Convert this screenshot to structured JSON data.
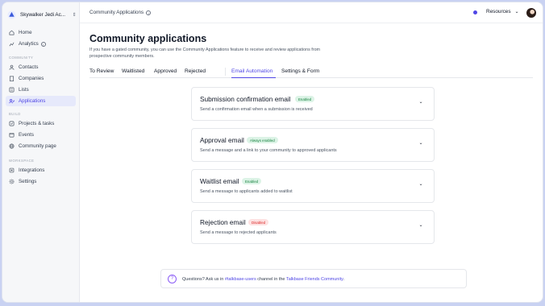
{
  "workspace": {
    "name": "Skywalker Jedi Ac...",
    "caret_icon": "chevron-updown-icon"
  },
  "sidebar": {
    "top_items": [
      {
        "label": "Home",
        "icon": "home-icon"
      },
      {
        "label": "Analytics",
        "icon": "chart-icon"
      }
    ],
    "sections": [
      {
        "title": "COMMUNITY",
        "items": [
          {
            "label": "Contacts",
            "icon": "contacts-icon"
          },
          {
            "label": "Companies",
            "icon": "building-icon"
          },
          {
            "label": "Lists",
            "icon": "list-icon"
          },
          {
            "label": "Applications",
            "icon": "applications-icon",
            "active": true
          }
        ]
      },
      {
        "title": "BUILD",
        "items": [
          {
            "label": "Projects & tasks",
            "icon": "tasks-icon"
          },
          {
            "label": "Events",
            "icon": "calendar-icon"
          },
          {
            "label": "Community page",
            "icon": "globe-icon"
          }
        ]
      },
      {
        "title": "WORKSPACE",
        "items": [
          {
            "label": "Integrations",
            "icon": "integrations-icon"
          },
          {
            "label": "Settings",
            "icon": "gear-icon"
          }
        ]
      }
    ]
  },
  "topbar": {
    "breadcrumb": "Community Applications",
    "resources_label": "Resources"
  },
  "page": {
    "title": "Community applications",
    "description": "If you have a gated community, you can use the Community Applications feature to receive and review applications from prospective community members."
  },
  "tabs": [
    {
      "label": "To Review"
    },
    {
      "label": "Waitlisted"
    },
    {
      "label": "Approved"
    },
    {
      "label": "Rejected"
    },
    {
      "label": "Email Automation",
      "active": true
    },
    {
      "label": "Settings & Form"
    }
  ],
  "emails": [
    {
      "title": "Submission confirmation email",
      "badge": "Enabled",
      "badge_color": "green",
      "description": "Send a confirmation email when a submission is received"
    },
    {
      "title": "Approval email",
      "badge": "Always enabled",
      "badge_color": "green",
      "description": "Send a message and a link to your community to approved applicants"
    },
    {
      "title": "Waitlist email",
      "badge": "Enabled",
      "badge_color": "green",
      "description": "Send a message to applicants added to waitlist"
    },
    {
      "title": "Rejection email",
      "badge": "Disabled",
      "badge_color": "red",
      "description": "Send a message to rejected applicants"
    }
  ],
  "help": {
    "prefix": "Questions? Ask us in ",
    "channel": "#talkbase-users",
    "middle": " channel in the ",
    "community": "Talkbase Friends Community",
    "suffix": "."
  },
  "colors": {
    "accent": "#4f46e5",
    "enabled_bg": "#dcf3e6",
    "disabled_bg": "#fde2e2"
  }
}
